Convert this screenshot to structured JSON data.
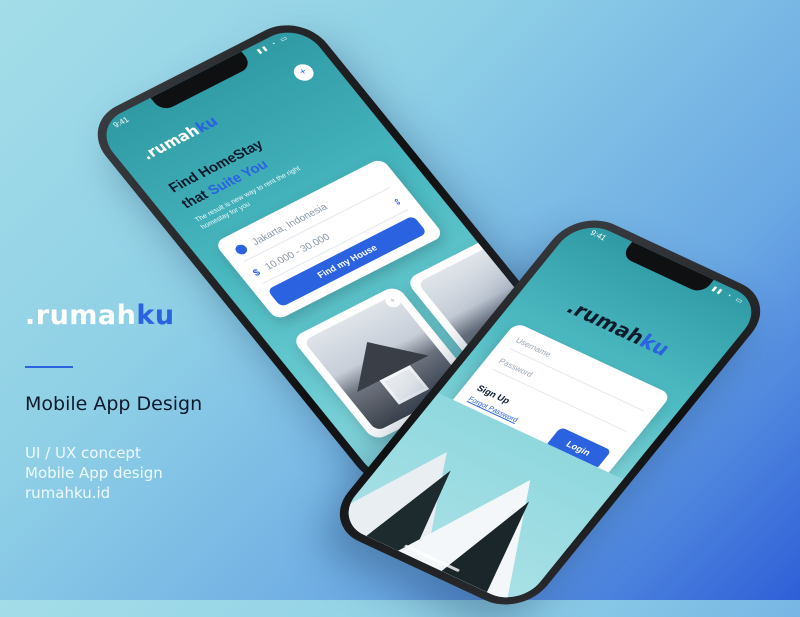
{
  "brand": {
    "logo_prefix": ".rumah",
    "logo_accent": "ku",
    "headline": "Mobile App Design",
    "subtitle_lines": [
      "UI / UX concept",
      "Mobile App design",
      "rumahku.id"
    ],
    "accent_color": "#2a62e0"
  },
  "phone_top": {
    "status_time": "9:41",
    "logo_prefix": ".rumah",
    "logo_accent": "ku",
    "menu_icon": "plus-icon",
    "title_line1": "Find HomeStay",
    "title_line2_prefix": "that ",
    "title_line2_accent": "Suite You",
    "description": "The result is new way to rent the right homestay for you",
    "search": {
      "location_value": "Jakarta, Indonesia",
      "location_icon": "location-pin-icon",
      "price_value": "10.000 - 30.000",
      "price_icon": "dollar-icon",
      "button_label": "Find my House"
    }
  },
  "phone_bottom": {
    "status_time": "9:41",
    "logo_prefix": ".rumah",
    "logo_accent": "ku",
    "username_placeholder": "Username",
    "password_placeholder": "Password",
    "signup_label": "Sign Up",
    "forgot_label": "Forgot Password",
    "login_label": "Login"
  }
}
